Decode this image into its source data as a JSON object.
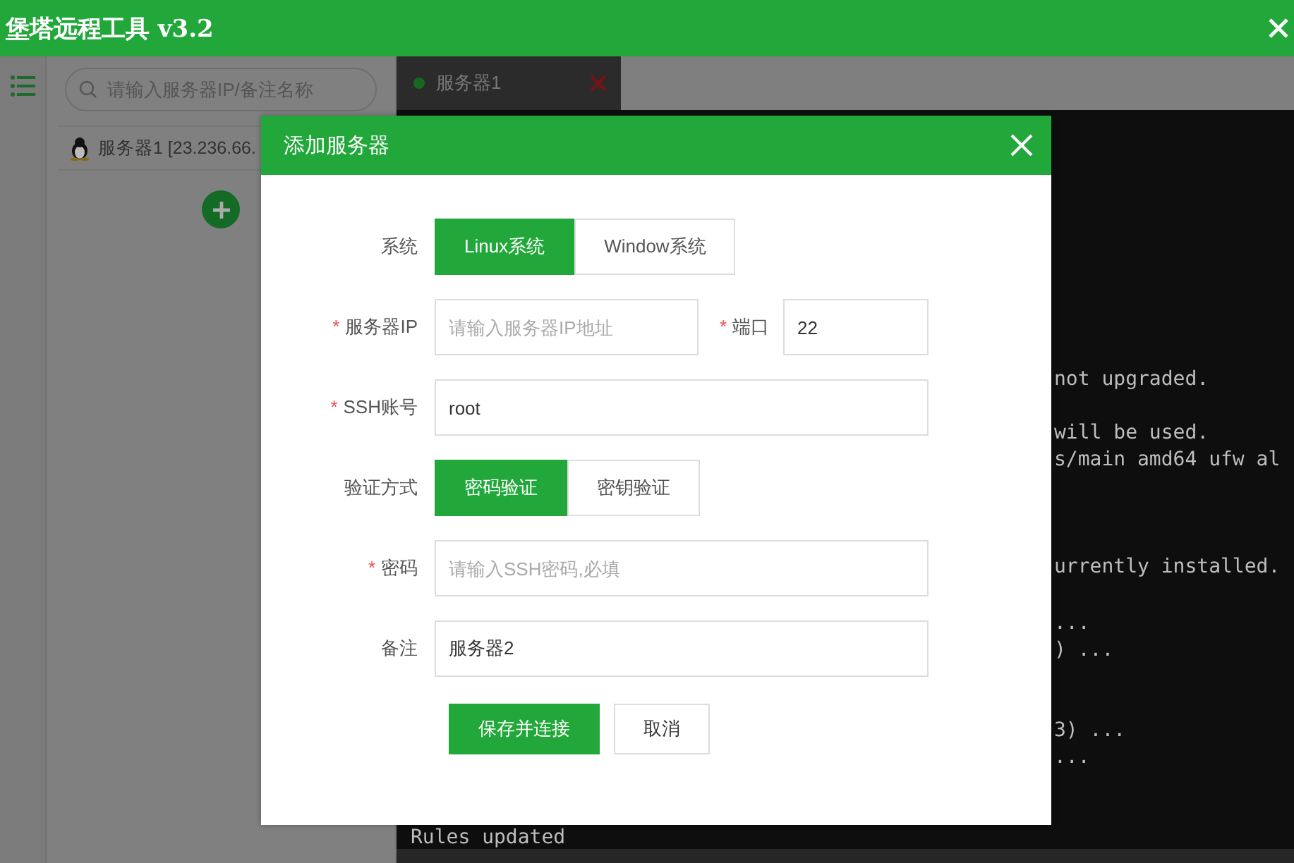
{
  "window": {
    "title": "堡塔远程工具 v3.2"
  },
  "sidebar": {
    "search": {
      "placeholder": "请输入服务器IP/备注名称"
    },
    "servers": [
      {
        "name": "服务器1 [23.236.66."
      }
    ]
  },
  "tabs": [
    {
      "label": "服务器1",
      "selected": true,
      "connected": true
    }
  ],
  "terminal": {
    "lines": [
      {
        "text": "not upgraded.",
        "kind": "tail"
      },
      {
        "text": "will be used.",
        "kind": "tail"
      },
      {
        "text": "s/main amd64 ufw al",
        "kind": "tail"
      },
      {
        "text": "urrently installed.",
        "kind": "tail"
      },
      {
        "text": "...",
        "kind": "tail"
      },
      {
        "text": ") ...",
        "kind": "tail"
      },
      {
        "text": "3) ...",
        "kind": "tail"
      },
      {
        "text": "...",
        "kind": "tail"
      },
      {
        "text": "Rules updated",
        "kind": "full"
      }
    ]
  },
  "dialog": {
    "title": "添加服务器",
    "rows": [
      {
        "kind": "segmented",
        "label": "系统",
        "options": [
          {
            "label": "Linux系统",
            "selected": true
          },
          {
            "label": "Window系统",
            "selected": false
          }
        ]
      },
      {
        "kind": "pair",
        "label": "服务器IP",
        "mark": "*",
        "placeholder": "请输入服务器IP地址",
        "second_label": "端口",
        "second_mark": "*",
        "second_value": "22"
      },
      {
        "kind": "input",
        "label": "SSH账号",
        "mark": "*",
        "value": "root"
      },
      {
        "kind": "segmented",
        "label": "验证方式",
        "options": [
          {
            "label": "密码验证",
            "selected": true
          },
          {
            "label": "密钥验证",
            "selected": false
          }
        ]
      },
      {
        "kind": "input",
        "label": "密码",
        "mark": "*",
        "placeholder": "请输入SSH密码,必填"
      },
      {
        "kind": "input",
        "label": "备注",
        "value": "服务器2"
      }
    ],
    "buttons": [
      {
        "label": "保存并连接",
        "kind": "primary"
      },
      {
        "label": "取消",
        "kind": "default"
      }
    ]
  }
}
